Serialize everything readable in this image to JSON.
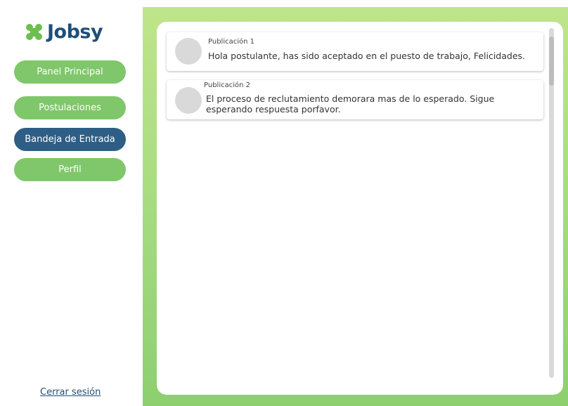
{
  "brand": {
    "name": "Jobsy",
    "accent": "#6cbf4f",
    "text_color": "#1f4e79"
  },
  "nav": {
    "items": [
      {
        "label": "Panel Principal",
        "active": false
      },
      {
        "label": "Postulaciones",
        "active": false
      },
      {
        "label": "Bandeja de Entrada",
        "active": true
      },
      {
        "label": "Perfil",
        "active": false
      }
    ],
    "logout_label": "Cerrar sesión"
  },
  "inbox": {
    "messages": [
      {
        "title": "Publicación 1",
        "body": "Hola postulante, has sido aceptado en el puesto de trabajo, Felicidades."
      },
      {
        "title": "Publicación 2",
        "body": "El proceso de reclutamiento demorara mas de lo esperado. Sigue esperando respuesta porfavor."
      }
    ]
  },
  "colors": {
    "nav_button": "#7fc76a",
    "nav_active": "#2e5e85",
    "background_gradient_top": "#bfe58a",
    "background_gradient_bottom": "#8dcf6f"
  }
}
